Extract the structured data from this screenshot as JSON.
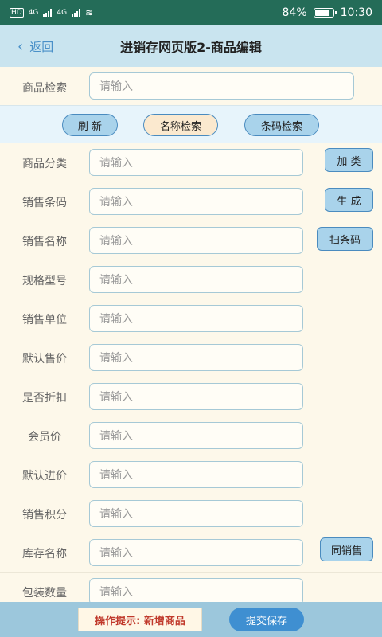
{
  "statusbar": {
    "left_text": "HD",
    "net1": "4G",
    "net2": "4G",
    "battery_pct": "84%",
    "battery_level": 0.84,
    "time": "10:30"
  },
  "header": {
    "back_label": "返回",
    "title": "进销存网页版2-商品编辑"
  },
  "search": {
    "label": "商品检索",
    "placeholder": "请输入"
  },
  "toolbar": {
    "refresh": "刷 新",
    "name_search": "名称检索",
    "barcode_search": "条码检索"
  },
  "fields": [
    {
      "label": "商品分类",
      "placeholder": "请输入"
    },
    {
      "label": "销售条码",
      "placeholder": "请输入"
    },
    {
      "label": "销售名称",
      "placeholder": "请输入"
    },
    {
      "label": "规格型号",
      "placeholder": "请输入"
    },
    {
      "label": "销售单位",
      "placeholder": "请输入"
    },
    {
      "label": "默认售价",
      "placeholder": "请输入"
    },
    {
      "label": "是否折扣",
      "placeholder": "请输入"
    },
    {
      "label": "会员价",
      "placeholder": "请输入"
    },
    {
      "label": "默认进价",
      "placeholder": "请输入"
    },
    {
      "label": "销售积分",
      "placeholder": "请输入"
    },
    {
      "label": "库存名称",
      "placeholder": "请输入"
    },
    {
      "label": "包装数量",
      "placeholder": "请输入"
    }
  ],
  "side_buttons": {
    "add_category": "加 类",
    "generate": "生 成",
    "scan_barcode": "扫条码",
    "same_as_sales": "同销售"
  },
  "footer": {
    "hint": "操作提示: 新增商品",
    "submit": "提交保存"
  },
  "colors": {
    "statusbar": "#246c58",
    "header": "#c9e4ef",
    "accent": "#3f8fd1",
    "background": "#fdf8ea"
  }
}
